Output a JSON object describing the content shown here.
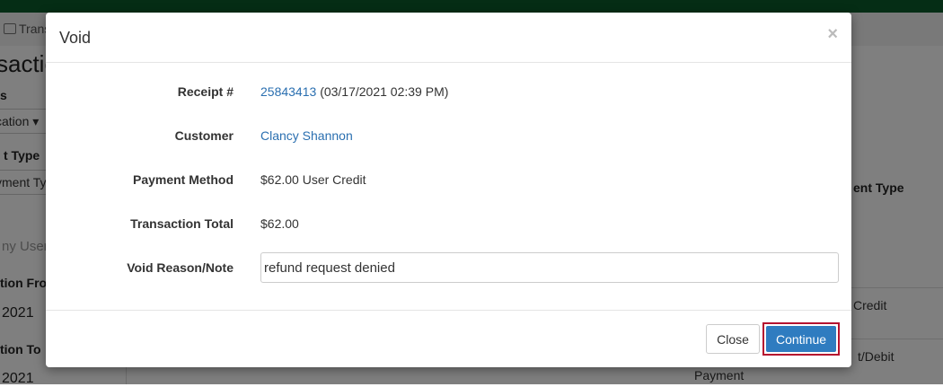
{
  "background": {
    "breadcrumb": "Trans",
    "page_title": "sactio",
    "frag_s": "s",
    "location_select": "cation",
    "payment_type_label": "t Type",
    "payment_type_select": "yment Ty",
    "any_user_placeholder": "ny User",
    "from_label": "tion From",
    "from_date": "2021",
    "to_label": "tion To",
    "to_date": "2021",
    "payment_type_header": "ent Type",
    "cell_credit": "Credit",
    "cell_debit": "t/Debit",
    "cell_payment": "Payment"
  },
  "modal": {
    "title": "Void",
    "close_symbol": "×",
    "receipt_label": "Receipt #",
    "receipt_number": "25843413",
    "receipt_date": "(03/17/2021 02:39 PM)",
    "customer_label": "Customer",
    "customer_name": "Clancy Shannon",
    "payment_method_label": "Payment Method",
    "payment_method_value": "$62.00 User Credit",
    "transaction_total_label": "Transaction Total",
    "transaction_total_value": "$62.00",
    "void_reason_label": "Void Reason/Note",
    "void_reason_value": "refund request denied",
    "close_button": "Close",
    "continue_button": "Continue"
  },
  "colors": {
    "topbar": "#0b5a2a",
    "link": "#2a6fb0",
    "primary_button": "#2f7cc0",
    "highlight_border": "#b5122f"
  }
}
